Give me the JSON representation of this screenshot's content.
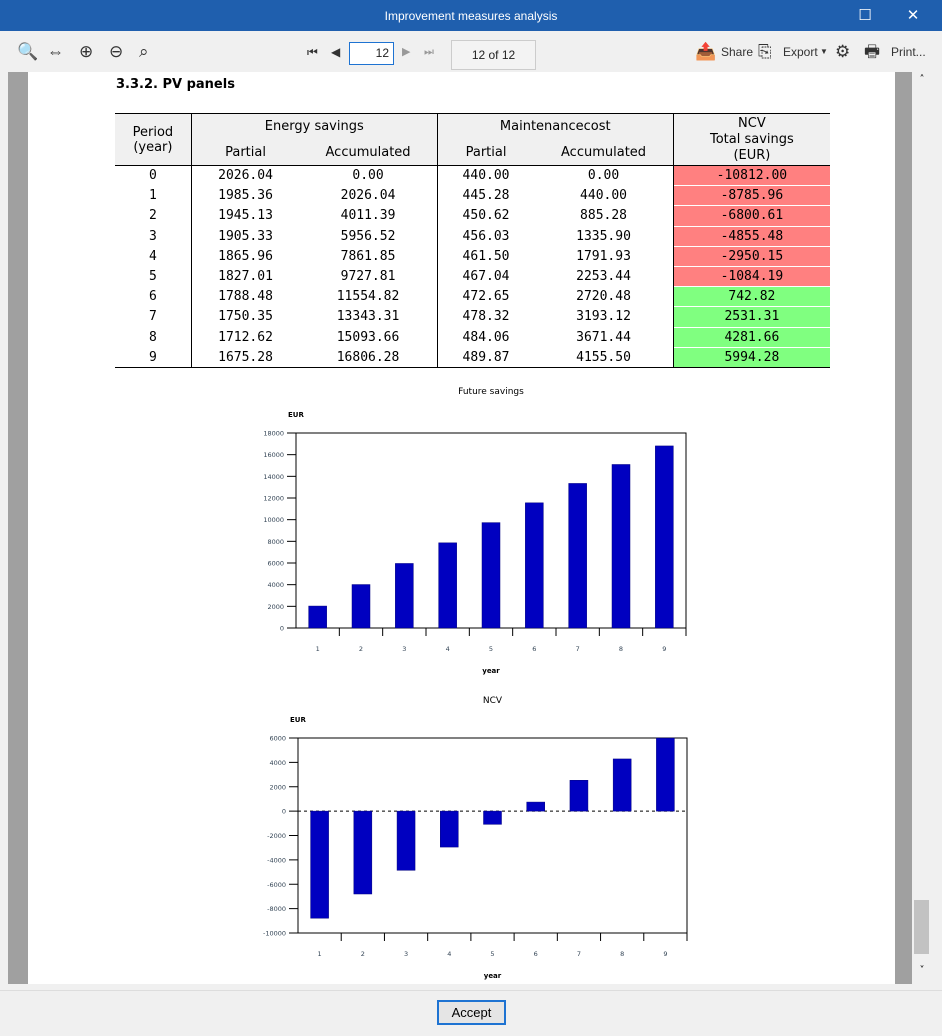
{
  "window": {
    "title": "Improvement measures analysis",
    "maximize": "☐",
    "close": "✕"
  },
  "toolbar": {
    "page_value": "12",
    "page_of": "12 of 12",
    "share": "Share",
    "export": "Export",
    "print": "Print..."
  },
  "heading": "3.3.2. PV panels",
  "table": {
    "h_period": "Period",
    "h_period2": "(year)",
    "h_energy": "Energy savings",
    "h_maint": "Maintenancecost",
    "h_ncv1": "NCV",
    "h_ncv2": "Total savings",
    "h_ncv3": "(EUR)",
    "h_partial": "Partial",
    "h_accum": "Accumulated",
    "rows": [
      [
        "0",
        "2026.04",
        "0.00",
        "440.00",
        "0.00",
        "-10812.00"
      ],
      [
        "1",
        "1985.36",
        "2026.04",
        "445.28",
        "440.00",
        "-8785.96"
      ],
      [
        "2",
        "1945.13",
        "4011.39",
        "450.62",
        "885.28",
        "-6800.61"
      ],
      [
        "3",
        "1905.33",
        "5956.52",
        "456.03",
        "1335.90",
        "-4855.48"
      ],
      [
        "4",
        "1865.96",
        "7861.85",
        "461.50",
        "1791.93",
        "-2950.15"
      ],
      [
        "5",
        "1827.01",
        "9727.81",
        "467.04",
        "2253.44",
        "-1084.19"
      ],
      [
        "6",
        "1788.48",
        "11554.82",
        "472.65",
        "2720.48",
        "742.82"
      ],
      [
        "7",
        "1750.35",
        "13343.31",
        "478.32",
        "3193.12",
        "2531.31"
      ],
      [
        "8",
        "1712.62",
        "15093.66",
        "484.06",
        "3671.44",
        "4281.66"
      ],
      [
        "9",
        "1675.28",
        "16806.28",
        "489.87",
        "4155.50",
        "5994.28"
      ]
    ]
  },
  "chart_data": [
    {
      "type": "bar",
      "title": "Future savings",
      "ylabel": "EUR",
      "xlabel": "year",
      "categories": [
        "1",
        "2",
        "3",
        "4",
        "5",
        "6",
        "7",
        "8",
        "9"
      ],
      "values": [
        2026.04,
        4011.39,
        5956.52,
        7861.85,
        9727.81,
        11554.82,
        13343.31,
        15093.66,
        16806.28
      ],
      "ylim": [
        0,
        18000
      ],
      "yticks": [
        "0",
        "2000",
        "4000",
        "6000",
        "8000",
        "10000",
        "12000",
        "14000",
        "16000",
        "18000"
      ],
      "color": "#0000c0"
    },
    {
      "type": "bar",
      "title": "NCV",
      "ylabel": "EUR",
      "xlabel": "year",
      "categories": [
        "1",
        "2",
        "3",
        "4",
        "5",
        "6",
        "7",
        "8",
        "9"
      ],
      "values": [
        -8785.96,
        -6800.61,
        -4855.48,
        -2950.15,
        -1084.19,
        742.82,
        2531.31,
        4281.66,
        5994.28
      ],
      "ylim": [
        -10000,
        6000
      ],
      "yticks": [
        "-10000",
        "-8000",
        "-6000",
        "-4000",
        "-2000",
        "0",
        "2000",
        "4000",
        "6000"
      ],
      "color": "#0000c0"
    }
  ],
  "footer": {
    "accept": "Accept"
  }
}
